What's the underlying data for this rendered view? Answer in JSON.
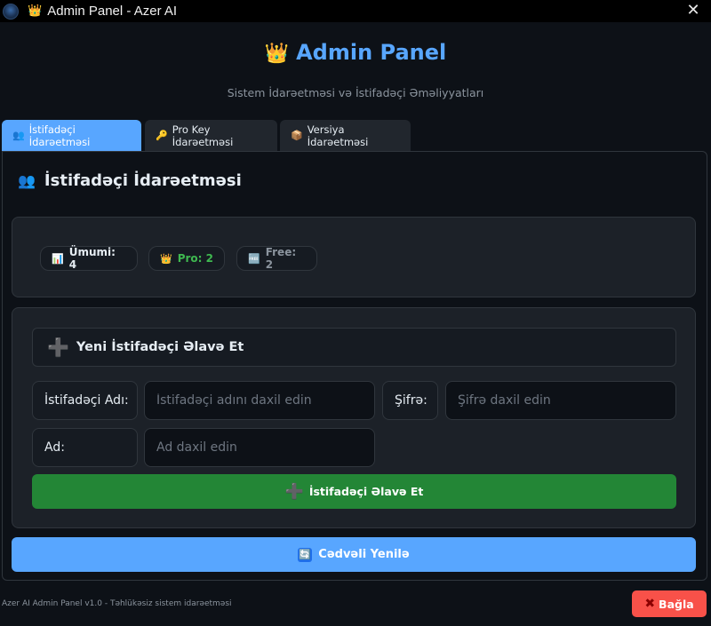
{
  "window": {
    "title": "Admin Panel - Azer AI",
    "title_icon": "👑",
    "close_glyph": "✕"
  },
  "header": {
    "icon": "👑",
    "title": "Admin Panel",
    "subtitle": "Sistem İdarəetməsi və İstifadəçi Əməliyyatları"
  },
  "tabs": [
    {
      "icon": "👥",
      "label": "İstifadəçi İdarəetməsi",
      "active": true
    },
    {
      "icon": "🔑",
      "label": "Pro Key İdarəetməsi",
      "active": false
    },
    {
      "icon": "📦",
      "label": "Versiya İdarəetməsi",
      "active": false
    }
  ],
  "section": {
    "icon": "👥",
    "title": "İstifadəçi İdarəetməsi"
  },
  "stats": {
    "total": {
      "icon": "📊",
      "label": "Ümumi: 4"
    },
    "pro": {
      "icon": "👑",
      "label": "Pro: 2"
    },
    "free": {
      "icon": "🆓",
      "label": "Free: 2"
    }
  },
  "form": {
    "header_icon": "➕",
    "header": "Yeni İstifadəçi Əlavə Et",
    "username_label": "İstifadəçi Adı:",
    "username_placeholder": "İstifadəçi adını daxil edin",
    "username_value": "",
    "password_label": "Şifrə:",
    "password_placeholder": "Şifrə daxil edin",
    "password_value": "",
    "name_label": "Ad:",
    "name_placeholder": "Ad daxil edin",
    "name_value": "",
    "submit_icon": "➕",
    "submit_label": "İstifadəçi Əlavə Et"
  },
  "refresh": {
    "icon": "🔄",
    "label": "Cədvəli Yenilə"
  },
  "footer": {
    "text": "Azer AI Admin Panel v1.0 - Təhlükəsiz sistem idarəetməsi",
    "close_icon": "✖",
    "close_label": "Bağla"
  },
  "colors": {
    "accent": "#58a6ff",
    "success": "#238636",
    "danger": "#f85149",
    "background": "#0d1117"
  }
}
